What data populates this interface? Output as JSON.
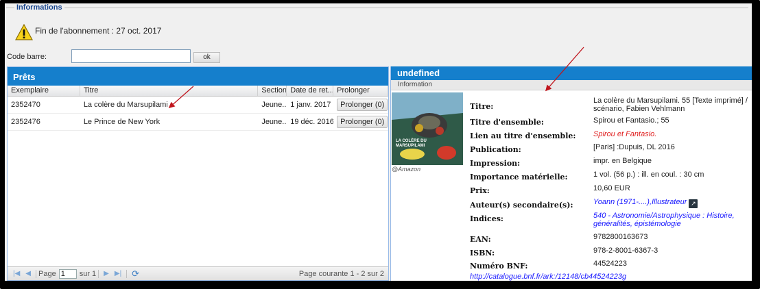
{
  "info": {
    "legend": "Informations",
    "message": "Fin de l'abonnement : 27 oct. 2017"
  },
  "barcode": {
    "label": "Code barre:",
    "value": "",
    "button": "ok"
  },
  "loans": {
    "title": "Prêts",
    "columns": [
      "Exemplaire",
      "Titre",
      "Section",
      "Date de ret...",
      "Prolonger"
    ],
    "rows": [
      {
        "copy": "2352470",
        "title": "La colère du Marsupilami",
        "section": "Jeune...",
        "date": "1 janv. 2017",
        "extend": "Prolonger (0)"
      },
      {
        "copy": "2352476",
        "title": "Le Prince de New York",
        "section": "Jeune...",
        "date": "19 déc. 2016",
        "extend": "Prolonger (0)"
      }
    ],
    "pager": {
      "page_label": "Page",
      "page_value": "1",
      "of_label": "sur 1",
      "status": "Page courante 1 - 2 sur 2"
    }
  },
  "detail": {
    "title": "undefined",
    "subtitle": "Information",
    "cover_credit": "@Amazon",
    "cover_text": "LA COLÈRE DU MARSUPILAMI",
    "fields": [
      {
        "label": "Titre:",
        "value": "La colère du Marsupilami. 55 [Texte imprimé] / scénario, Fabien Vehlmann"
      },
      {
        "label": "Titre d'ensemble:",
        "value": "Spirou et Fantasio.; 55"
      },
      {
        "label": "Lien au titre d'ensemble:",
        "value": "Spirou et Fantasio."
      },
      {
        "label": "Publication:",
        "value": "[Paris] :Dupuis, DL 2016"
      },
      {
        "label": "Impression:",
        "value": "impr. en Belgique"
      },
      {
        "label": "Importance matérielle:",
        "value": "1 vol. (56 p.) : ill. en coul. : 30 cm"
      },
      {
        "label": "Prix:",
        "value": "10,60 EUR"
      },
      {
        "label": "Auteur(s) secondaire(s):",
        "value": "Yoann (1971-....),Illustrateur"
      },
      {
        "label": "Indices:",
        "value": "540 - Astronomie/Astrophysique : Histoire, généralités, épistémologie"
      },
      {
        "label": "EAN:",
        "value": "9782800163673"
      },
      {
        "label": "ISBN:",
        "value": "978-2-8001-6367-3"
      },
      {
        "label": "Numéro BNF:",
        "value": "44524223"
      }
    ],
    "bnf_link": "http://catalogue.bnf.fr/ark:/12148/cb44524223g"
  },
  "colors": {
    "header_blue": "#157fcc",
    "arrow_red": "#c0141c",
    "link_blue": "#1a1aff"
  }
}
